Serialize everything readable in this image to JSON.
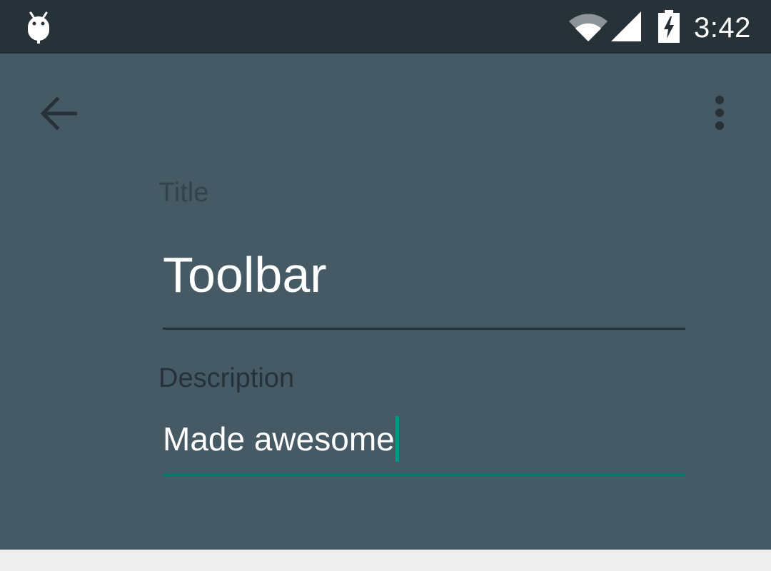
{
  "status_bar": {
    "time": "3:42",
    "background": "#263238",
    "icons": [
      "android-icon",
      "wifi-icon",
      "cell-signal-icon",
      "battery-charging-icon"
    ]
  },
  "toolbar": {
    "background": "#455a64",
    "accent": "#009688",
    "nav_icon": "arrow-back-icon",
    "menu_icon": "more-vert-icon"
  },
  "form": {
    "title_label": "Title",
    "title_value": "Toolbar",
    "description_label": "Description",
    "description_value": "Made awesome"
  }
}
